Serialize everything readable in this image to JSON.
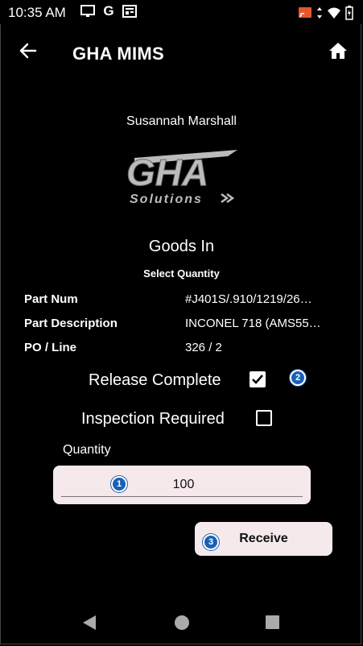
{
  "status_bar": {
    "time": "10:35 AM",
    "left_icons": [
      "cast-screen-icon",
      "google-g-icon",
      "news-icon"
    ],
    "right_icons": [
      "cast-icon",
      "data-arrows-icon",
      "wifi-icon",
      "battery-icon"
    ],
    "google_letter": "G"
  },
  "app_bar": {
    "title": "GHA MIMS"
  },
  "user": {
    "name": "Susannah Marshall"
  },
  "logo": {
    "text_main": "GHA",
    "text_sub": "Solutions"
  },
  "page": {
    "title": "Goods In",
    "subtitle": "Select Quantity"
  },
  "info": [
    {
      "label": "Part Num",
      "value": "#J401S/.910/1219/26…"
    },
    {
      "label": "Part Description",
      "value": "INCONEL 718 (AMS55…"
    },
    {
      "label": "PO / Line",
      "value": "326 / 2"
    }
  ],
  "options": {
    "release_complete": {
      "label": "Release Complete",
      "checked": true
    },
    "inspection_required": {
      "label": "Inspection Required",
      "checked": false
    }
  },
  "quantity": {
    "label": "Quantity",
    "value": "100"
  },
  "actions": {
    "receive_label": "Receive"
  },
  "badges": {
    "quantity": "1",
    "release": "2",
    "receive": "3"
  },
  "colors": {
    "background": "#000000",
    "field_bg": "#f5e9ec",
    "badge": "#1a5fb4"
  }
}
